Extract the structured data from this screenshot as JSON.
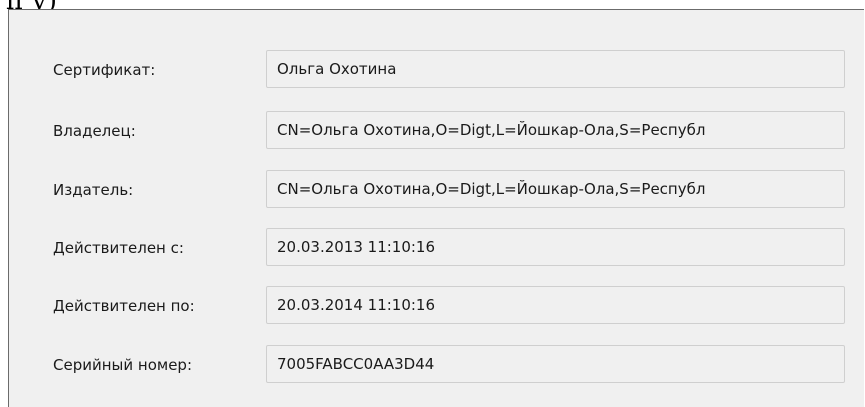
{
  "header_fragment": "п                     у)",
  "fields": [
    {
      "label": "Сертификат:",
      "value": "Ольга Охотина"
    },
    {
      "label": "Владелец:",
      "value": "CN=Ольга Охотина,O=Digt,L=Йошкар-Ола,S=Республ"
    },
    {
      "label": "Издатель:",
      "value": "CN=Ольга Охотина,O=Digt,L=Йошкар-Ола,S=Республ"
    },
    {
      "label": "Действителен с:",
      "value": "20.03.2013 11:10:16"
    },
    {
      "label": "Действителен по:",
      "value": "20.03.2014 11:10:16"
    },
    {
      "label": "Серийный номер:",
      "value": "7005FABCC0AA3D44"
    }
  ]
}
